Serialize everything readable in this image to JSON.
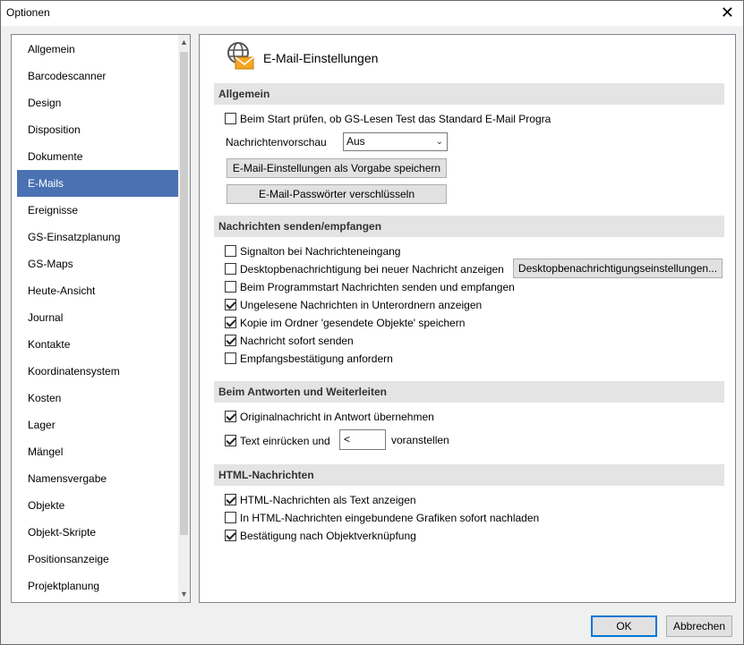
{
  "window": {
    "title": "Optionen",
    "close_glyph": "✕"
  },
  "nav": {
    "items": [
      "Allgemein",
      "Barcodescanner",
      "Design",
      "Disposition",
      "Dokumente",
      "E-Mails",
      "Ereignisse",
      "GS-Einsatzplanung",
      "GS-Maps",
      "Heute-Ansicht",
      "Journal",
      "Kontakte",
      "Koordinatensystem",
      "Kosten",
      "Lager",
      "Mängel",
      "Namensvergabe",
      "Objekte",
      "Objekt-Skripte",
      "Positionsanzeige",
      "Projektplanung"
    ],
    "selected_index": 5,
    "scroll_up_glyph": "▲",
    "scroll_down_glyph": "▼"
  },
  "header": {
    "title": "E-Mail-Einstellungen",
    "icon": "email-settings-icon"
  },
  "sections": {
    "general": {
      "title": "Allgemein",
      "check_default_client": {
        "label": "Beim Start prüfen, ob GS-Lesen Test das Standard E-Mail Progra",
        "checked": false
      },
      "preview_label": "Nachrichtenvorschau",
      "preview_value": "Aus",
      "save_default_button": "E-Mail-Einstellungen als Vorgabe speichern",
      "encrypt_button": "E-Mail-Passwörter verschlüsseln"
    },
    "send_receive": {
      "title": "Nachrichten senden/empfangen",
      "sound": {
        "label": "Signalton bei Nachrichteneingang",
        "checked": false
      },
      "desktop_notify": {
        "label": "Desktopbenachrichtigung bei neuer Nachricht anzeigen",
        "checked": false
      },
      "desktop_settings_button": "Desktopbenachrichtigungseinstellungen...",
      "send_on_start": {
        "label": "Beim Programmstart Nachrichten senden und empfangen",
        "checked": false
      },
      "unread_subfolders": {
        "label": "Ungelesene Nachrichten in Unterordnern anzeigen",
        "checked": true
      },
      "copy_sent": {
        "label": "Kopie im Ordner 'gesendete Objekte' speichern",
        "checked": true
      },
      "send_immediately": {
        "label": "Nachricht sofort senden",
        "checked": true
      },
      "read_receipt": {
        "label": "Empfangsbestätigung anfordern",
        "checked": false
      }
    },
    "reply": {
      "title": "Beim Antworten und Weiterleiten",
      "include_original": {
        "label": "Originalnachricht in Antwort übernehmen",
        "checked": true
      },
      "indent": {
        "label": "Text einrücken und",
        "checked": true
      },
      "indent_prefix": "<",
      "indent_suffix": "voranstellen"
    },
    "html": {
      "title": "HTML-Nachrichten",
      "as_text": {
        "label": "HTML-Nachrichten als Text anzeigen",
        "checked": true
      },
      "load_images": {
        "label": "In HTML-Nachrichten eingebundene Grafiken sofort nachladen",
        "checked": false
      },
      "confirm_link": {
        "label": "Bestätigung nach Objektverknüpfung",
        "checked": true
      }
    }
  },
  "footer": {
    "ok": "OK",
    "cancel": "Abbrechen"
  }
}
